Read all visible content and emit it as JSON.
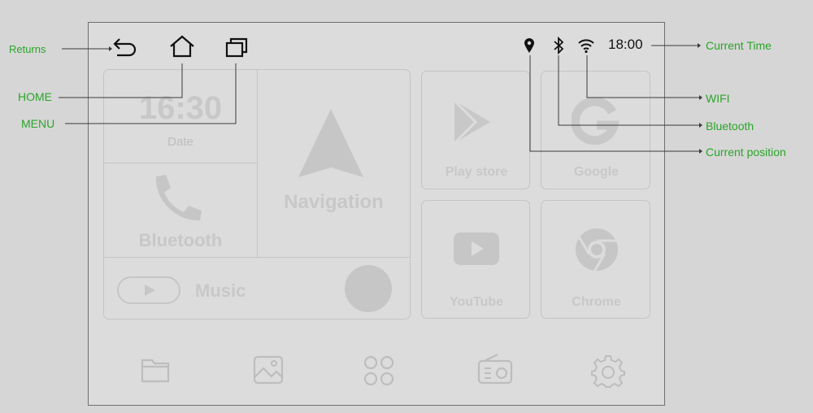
{
  "status_bar": {
    "time": "18:00"
  },
  "tiles": {
    "clock": {
      "time": "16:30",
      "date_label": "Date"
    },
    "bluetooth": {
      "label": "Bluetooth"
    },
    "navigation": {
      "label": "Navigation"
    },
    "music": {
      "label": "Music"
    },
    "play_store": {
      "label": "Play store"
    },
    "google": {
      "label": "Google"
    },
    "youtube": {
      "label": "YouTube"
    },
    "chrome": {
      "label": "Chrome"
    }
  },
  "annotations": {
    "returns": "Returns",
    "home": "HOME",
    "menu": "MENU",
    "current_time": "Current Time",
    "wifi": "WIFI",
    "bluetooth": "Bluetooth",
    "current_position": "Current position"
  },
  "colors": {
    "annotation": "#2aa52a",
    "faint": "#c8c8c8",
    "screen": "#dcdcdc"
  }
}
